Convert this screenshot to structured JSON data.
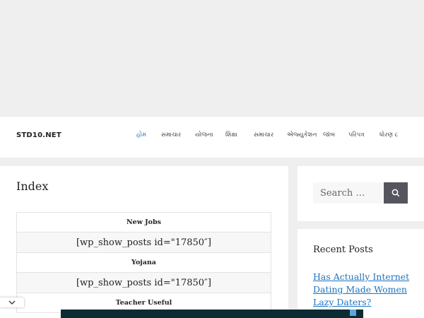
{
  "header": {
    "logo": "STD10.NET",
    "nav": [
      {
        "label": "હોમ",
        "active": true
      },
      {
        "label": "સમાચાર"
      },
      {
        "label": "યોજના"
      },
      {
        "label": "શિક્ષા"
      },
      {
        "label": "સમાચાર"
      },
      {
        "label": "એજ્યુકેશન"
      },
      {
        "label": "જૉબ"
      },
      {
        "label": "પરિપત્ર"
      },
      {
        "label": "ધોરણ ૮"
      }
    ]
  },
  "main": {
    "title": "Index",
    "table": [
      {
        "type": "header",
        "text": "New Jobs"
      },
      {
        "type": "shortcode",
        "text": "[wp_show_posts id=\"17850″]"
      },
      {
        "type": "header",
        "text": "Yojana"
      },
      {
        "type": "shortcode",
        "text": "[wp_show_posts id=\"17850″]"
      },
      {
        "type": "header",
        "text": "Teacher Useful"
      }
    ]
  },
  "sidebar": {
    "search": {
      "placeholder": "Search …"
    },
    "recent_title": "Recent Posts",
    "recent_posts": [
      "Has Actually Internet Dating Made Women Lazy Daters?"
    ]
  },
  "colors": {
    "link": "#1e73be",
    "search_button": "#55555e",
    "bottom_bar": "#0d2b33"
  }
}
